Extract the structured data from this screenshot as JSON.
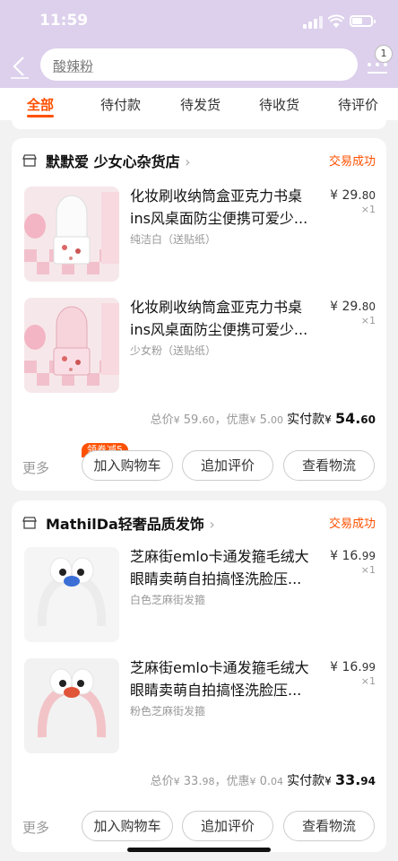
{
  "status_bar": {
    "time": "11:59"
  },
  "search": {
    "query": "酸辣粉"
  },
  "nav": {
    "message_badge": "1"
  },
  "tabs": [
    {
      "label": "全部",
      "active": true
    },
    {
      "label": "待付款"
    },
    {
      "label": "待发货"
    },
    {
      "label": "待收货"
    },
    {
      "label": "待评价"
    }
  ],
  "orders": [
    {
      "shop_name": "默默爱 少女心杂货店",
      "status": "交易成功",
      "items": [
        {
          "title": "化妆刷收纳筒盒亚克力书桌ins风桌面防尘便携可爱少...",
          "sku": "纯洁白（送贴纸）",
          "price_yen": "¥",
          "price_int": "29.",
          "price_dec": "80",
          "qty": "×1"
        },
        {
          "title": "化妆刷收纳筒盒亚克力书桌ins风桌面防尘便携可爱少...",
          "sku": "少女粉（送贴纸）",
          "price_yen": "¥",
          "price_int": "29.",
          "price_dec": "80",
          "qty": "×1"
        }
      ],
      "totals": {
        "total_label": "总价",
        "total_yen": "¥",
        "total_int": "59.",
        "total_dec": "60",
        "discount_label": "，优惠",
        "discount_yen": "¥",
        "discount_int": "5.",
        "discount_dec": "00",
        "paid_label": "实付款",
        "paid_yen": "¥",
        "paid_int": "54.",
        "paid_dec": "60"
      },
      "more": "更多",
      "coupon": "领券减5",
      "buttons": {
        "cart": "加入购物车",
        "review": "追加评价",
        "logistics": "查看物流"
      }
    },
    {
      "shop_name": "MathilDa轻奢品质发饰",
      "status": "交易成功",
      "items": [
        {
          "title": "芝麻街emlo卡通发箍毛绒大眼睛卖萌自拍搞怪洗脸压...",
          "sku": "白色芝麻街发箍",
          "price_yen": "¥",
          "price_int": "16.",
          "price_dec": "99",
          "qty": "×1"
        },
        {
          "title": "芝麻街emlo卡通发箍毛绒大眼睛卖萌自拍搞怪洗脸压...",
          "sku": "粉色芝麻街发箍",
          "price_yen": "¥",
          "price_int": "16.",
          "price_dec": "99",
          "qty": "×1"
        }
      ],
      "totals": {
        "total_label": "总价",
        "total_yen": "¥",
        "total_int": "33.",
        "total_dec": "98",
        "discount_label": "，优惠",
        "discount_yen": "¥",
        "discount_int": "0.",
        "discount_dec": "04",
        "paid_label": "实付款",
        "paid_yen": "¥",
        "paid_int": "33.",
        "paid_dec": "94"
      },
      "more": "更多",
      "buttons": {
        "cart": "加入购物车",
        "review": "追加评价",
        "logistics": "查看物流"
      }
    }
  ],
  "colors": {
    "accent": "#ff5000",
    "header": "#dcd0ec",
    "background": "#f2f2f2"
  },
  "icons": [
    "back-icon",
    "more-icon",
    "shop-icon",
    "chevron-right-icon"
  ]
}
